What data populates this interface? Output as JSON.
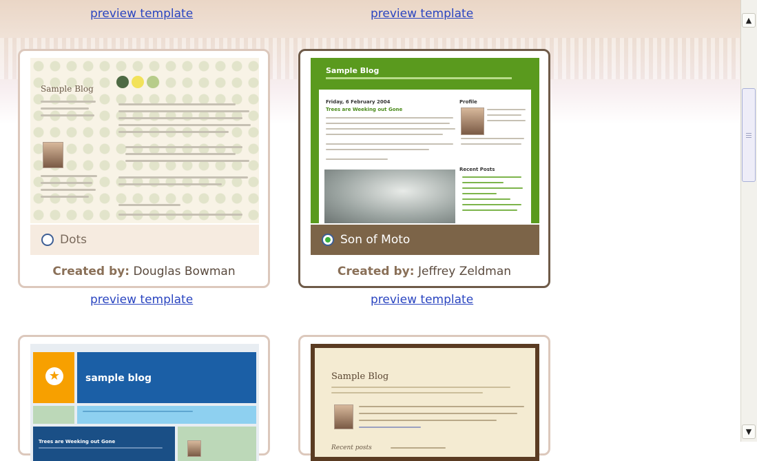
{
  "links": {
    "preview_label": "preview template"
  },
  "templates": [
    {
      "name": "Dots",
      "created_by_label": "Created by:",
      "author": "Douglas Bowman",
      "selected": false,
      "thumb": {
        "blog_title": "Sample Blog"
      },
      "colors": {
        "label_bg": "#f6ebe0",
        "label_text": "#7a6a5c"
      }
    },
    {
      "name": "Son of Moto",
      "created_by_label": "Created by:",
      "author": "Jeffrey Zeldman",
      "selected": true,
      "thumb": {
        "blog_title": "Sample Blog",
        "date": "Friday, 6 February 2004",
        "post_title": "Trees are Weeking out Gone",
        "profile": "Profile",
        "recent_posts": "Recent Posts"
      },
      "colors": {
        "label_bg": "#7c6448",
        "label_text": "#ffffff"
      }
    },
    {
      "thumb": {
        "blog_title": "sample blog",
        "post_title": "Trees are Weeking out Gone"
      }
    },
    {
      "thumb": {
        "blog_title": "Sample Blog",
        "post_title": "Recent posts"
      }
    }
  ],
  "scrollbar": {
    "up_icon": "up-arrow-icon",
    "down_icon": "down-arrow-icon"
  }
}
